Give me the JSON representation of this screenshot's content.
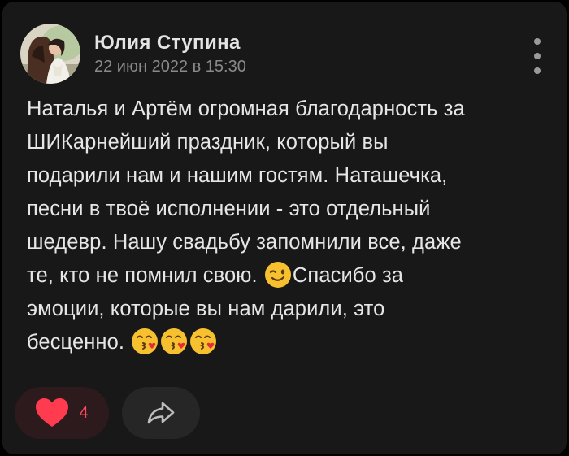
{
  "post": {
    "author": "Юлия Ступина",
    "date": "22 июн 2022 в 15:30",
    "lines": [
      "Наталья и Артём огромная благодарность за",
      "ШИКарнейший праздник, который вы",
      "подарили нам и нашим гостям. Наташечка,",
      "песни в твоё исполнении - это отдельный",
      "шедевр. Нашу свадьбу запомнили все, даже",
      "те, кто не помнил свою.",
      "Спасибо за",
      "эмоции, которые вы нам дарили, это",
      "бесценно."
    ],
    "emojis": {
      "wink": "winking-face-emoji",
      "kiss": "face-blowing-kiss-emoji"
    }
  },
  "actions": {
    "like_count": "4",
    "like_icon": "heart-icon",
    "share_icon": "share-arrow-icon",
    "more_icon": "more-vertical-icon"
  },
  "colors": {
    "background": "#000000",
    "card": "#181818",
    "text": "#e6e6e6",
    "secondary_text": "#8a8a8a",
    "like_accent": "#ff4a5d",
    "like_bg": "#2c1a1c",
    "share_bg": "#262626"
  }
}
